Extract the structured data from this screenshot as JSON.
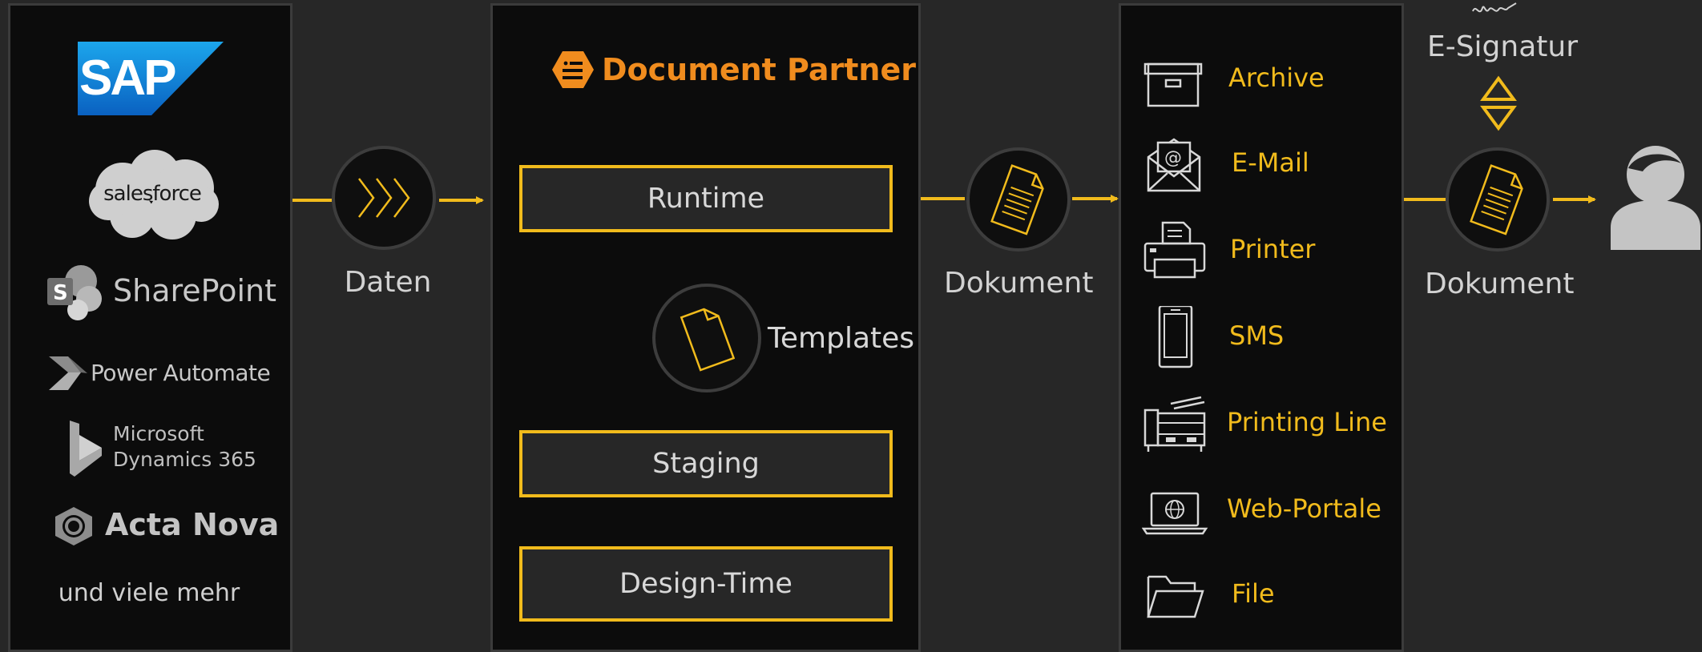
{
  "sources": {
    "sap": "SAP",
    "salesforce": "salesforce",
    "sharepoint": "SharePoint",
    "power_automate": "Power Automate",
    "dynamics_line1": "Microsoft",
    "dynamics_line2": "Dynamics 365",
    "acta_nova": "Acta Nova",
    "more": "und viele mehr"
  },
  "flow": {
    "daten": "Daten",
    "dokument1": "Dokument",
    "dokument2": "Dokument",
    "e_signatur": "E-Signatur"
  },
  "document_partner": {
    "title": "Document Partner",
    "runtime": "Runtime",
    "templates": "Templates",
    "staging": "Staging",
    "design_time": "Design-Time"
  },
  "channels": [
    {
      "label": "Archive",
      "icon": "archive-box-icon"
    },
    {
      "label": "E-Mail",
      "icon": "email-envelope-icon"
    },
    {
      "label": "Printer",
      "icon": "printer-icon"
    },
    {
      "label": "SMS",
      "icon": "phone-icon"
    },
    {
      "label": "Printing Line",
      "icon": "printing-line-icon"
    },
    {
      "label": "Web-Portale",
      "icon": "laptop-globe-icon"
    },
    {
      "label": "File",
      "icon": "folder-icon"
    }
  ],
  "colors": {
    "accent": "#f1bb1c",
    "orange": "#f08c1e",
    "panel": "#0c0c0c",
    "background": "#272727",
    "gray": "#c6c6c6"
  }
}
